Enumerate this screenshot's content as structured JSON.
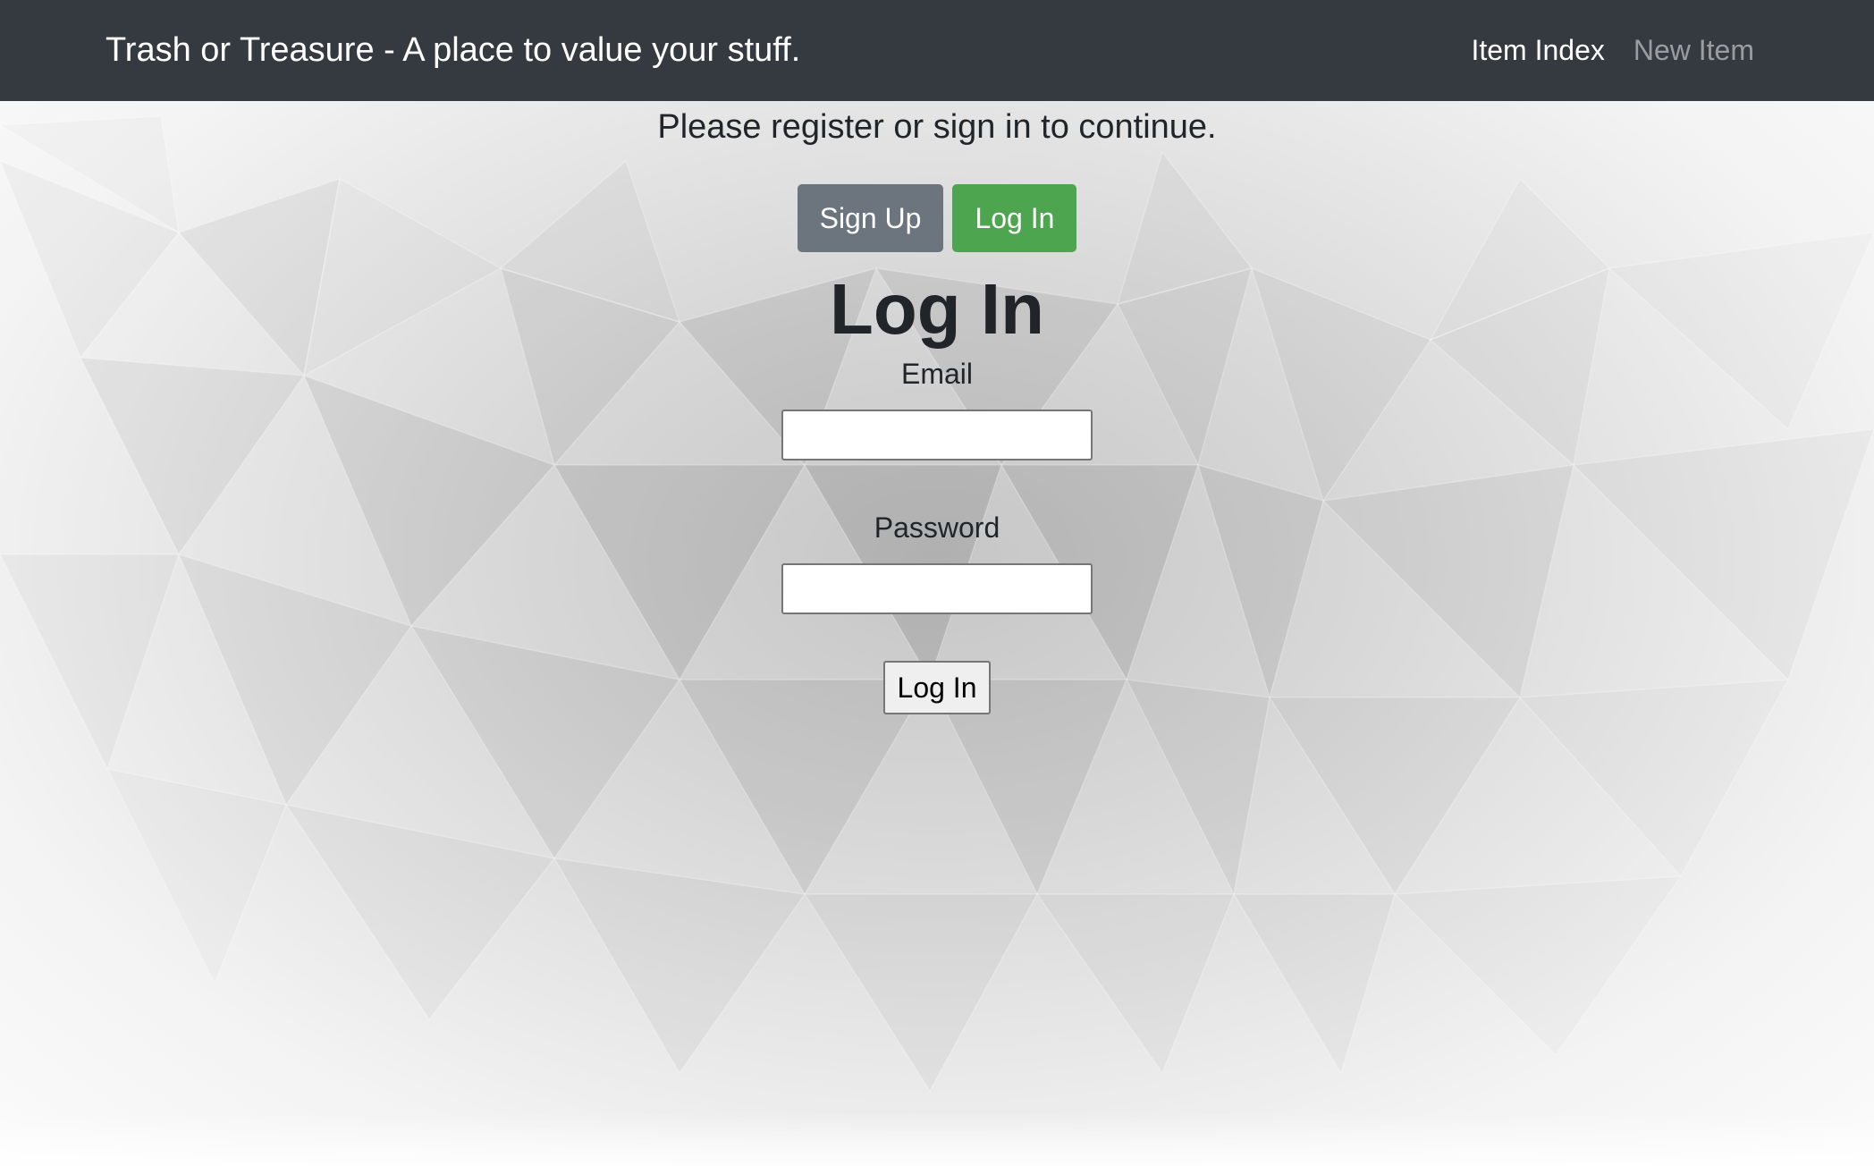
{
  "navbar": {
    "brand": "Trash or Treasure - A place to value your stuff.",
    "links": [
      {
        "label": "Item Index"
      },
      {
        "label": "New Item"
      }
    ]
  },
  "main": {
    "prompt": "Please register or sign in to continue.",
    "signup_label": "Sign Up",
    "login_tab_label": "Log In",
    "heading": "Log In",
    "email_label": "Email",
    "email_value": "",
    "password_label": "Password",
    "password_value": "",
    "submit_label": "Log In"
  },
  "colors": {
    "navbar_bg": "#343a40",
    "signup_bg": "#6c757d",
    "login_bg": "#4ea54f"
  }
}
